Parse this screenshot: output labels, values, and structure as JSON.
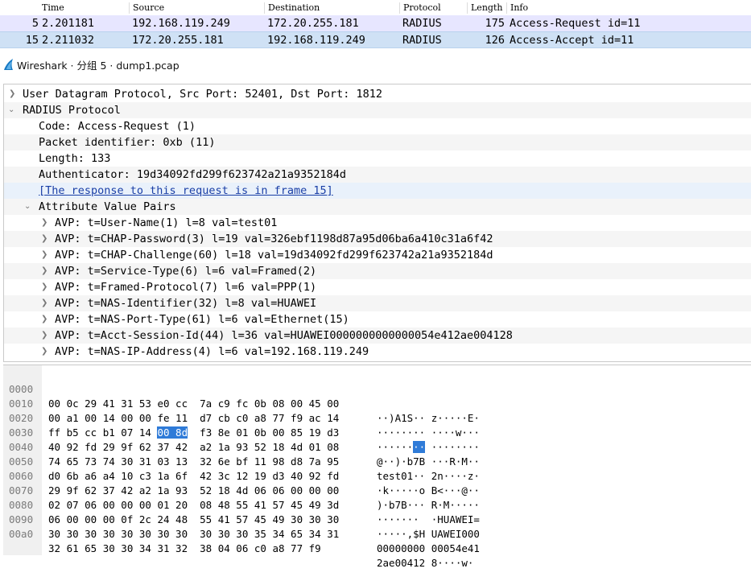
{
  "packet_list": {
    "headers": {
      "time": "Time",
      "source": "Source",
      "destination": "Destination",
      "protocol": "Protocol",
      "length": "Length",
      "info": "Info"
    },
    "rows": [
      {
        "no": "5",
        "time": "2.201181",
        "source": "192.168.119.249",
        "destination": "172.20.255.181",
        "protocol": "RADIUS",
        "length": "175",
        "info": "Access-Request id=11"
      },
      {
        "no": "15",
        "time": "2.211032",
        "source": "172.20.255.181",
        "destination": "192.168.119.249",
        "protocol": "RADIUS",
        "length": "126",
        "info": "Access-Accept id=11"
      }
    ]
  },
  "window": {
    "title": "Wireshark · 分组 5 · dump1.pcap",
    "icon": "wireshark-fin-icon"
  },
  "details": {
    "udp": "User Datagram Protocol, Src Port: 52401, Dst Port: 1812",
    "radius": "RADIUS Protocol",
    "code": "Code: Access-Request (1)",
    "packet_id": "Packet identifier: 0xb (11)",
    "length": "Length: 133",
    "authenticator": "Authenticator: 19d34092fd299f623742a21a9352184d",
    "response_link": "[The response to this request is in frame 15]",
    "avp_header": "Attribute Value Pairs",
    "avps": [
      "AVP: t=User-Name(1) l=8 val=test01",
      "AVP: t=CHAP-Password(3) l=19 val=326ebf1198d87a95d06ba6a410c31a6f42",
      "AVP: t=CHAP-Challenge(60) l=18 val=19d34092fd299f623742a21a9352184d",
      "AVP: t=Service-Type(6) l=6 val=Framed(2)",
      "AVP: t=Framed-Protocol(7) l=6 val=PPP(1)",
      "AVP: t=NAS-Identifier(32) l=8 val=HUAWEI",
      "AVP: t=NAS-Port-Type(61) l=6 val=Ethernet(15)",
      "AVP: t=Acct-Session-Id(44) l=36 val=HUAWEI0000000000000054e412ae004128",
      "AVP: t=NAS-IP-Address(4) l=6 val=192.168.119.249"
    ]
  },
  "hex": {
    "rows": [
      {
        "off": "0000",
        "a": "00 0c 29 41 31 53 e0 cc",
        "b": "7a c9 fc 0b 08 00 45 00",
        "asc_a": "··)A1S··",
        "asc_b": "z·····E·"
      },
      {
        "off": "0010",
        "a": "00 a1 00 14 00 00 fe 11",
        "b": "d7 cb c0 a8 77 f9 ac 14",
        "asc_a": "········",
        "asc_b": "····w···"
      },
      {
        "off": "0020",
        "a": "ff b5 cc b1 07 14 ",
        "a_hl": "00 8d",
        "b": "f3 8e 01 0b 00 85 19 d3",
        "asc_a": "······",
        "asc_a_hl": "··",
        "asc_b": "········"
      },
      {
        "off": "0030",
        "a": "40 92 fd 29 9f 62 37 42",
        "b": "a2 1a 93 52 18 4d 01 08",
        "asc_a": "@··)·b7B",
        "asc_b": "···R·M··"
      },
      {
        "off": "0040",
        "a": "74 65 73 74 30 31 03 13",
        "b": "32 6e bf 11 98 d8 7a 95",
        "asc_a": "test01··",
        "asc_b": "2n····z·"
      },
      {
        "off": "0050",
        "a": "d0 6b a6 a4 10 c3 1a 6f",
        "b": "42 3c 12 19 d3 40 92 fd",
        "asc_a": "·k·····o",
        "asc_b": "B<···@··"
      },
      {
        "off": "0060",
        "a": "29 9f 62 37 42 a2 1a 93",
        "b": "52 18 4d 06 06 00 00 00",
        "asc_a": ")·b7B···",
        "asc_b": "R·M·····"
      },
      {
        "off": "0070",
        "a": "02 07 06 00 00 00 01 20",
        "b": "08 48 55 41 57 45 49 3d",
        "asc_a": "······· ",
        "asc_b": "·HUAWEI="
      },
      {
        "off": "0080",
        "a": "06 00 00 00 0f 2c 24 48",
        "b": "55 41 57 45 49 30 30 30",
        "asc_a": "·····,$H",
        "asc_b": "UAWEI000"
      },
      {
        "off": "0090",
        "a": "30 30 30 30 30 30 30 30",
        "b": "30 30 30 35 34 65 34 31",
        "asc_a": "00000000",
        "asc_b": "00054e41"
      },
      {
        "off": "00a0",
        "a": "32 61 65 30 30 34 31 32",
        "b": "38 04 06 c0 a8 77 f9",
        "asc_a": "2ae00412",
        "asc_b": "8····w·"
      }
    ]
  },
  "colors": {
    "row1_bg": "#e7e6ff",
    "row2_bg": "#cfe1f5",
    "selection": "#2f7bd8",
    "link": "#1a3fa6"
  }
}
